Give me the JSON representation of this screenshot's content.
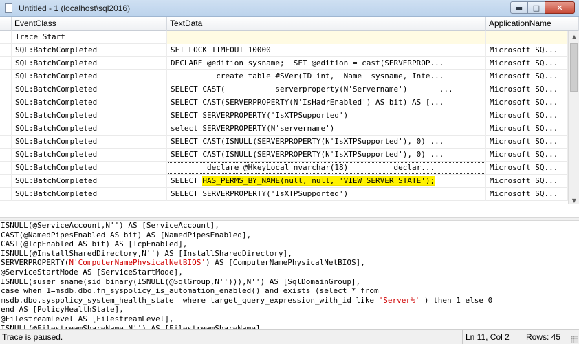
{
  "window": {
    "title": "Untitled - 1 (localhost\\sql2016)",
    "buttons": {
      "minimize": "▬",
      "maximize": "□",
      "close": "✕"
    }
  },
  "grid": {
    "columns": [
      "EventClass",
      "TextData",
      "ApplicationName"
    ],
    "rows": [
      {
        "event": "Trace Start",
        "text": "",
        "app": ""
      },
      {
        "event": "SQL:BatchCompleted",
        "text": "SET LOCK_TIMEOUT 10000",
        "app": "Microsoft SQ..."
      },
      {
        "event": "SQL:BatchCompleted",
        "text": "DECLARE @edition sysname;  SET @edition = cast(SERVERPROP...",
        "app": "Microsoft SQ..."
      },
      {
        "event": "SQL:BatchCompleted",
        "text": "          create table #SVer(ID int,  Name  sysname, Inte...",
        "app": "Microsoft SQ..."
      },
      {
        "event": "SQL:BatchCompleted",
        "text": "SELECT CAST(           serverproperty(N'Servername')       ...",
        "app": "Microsoft SQ..."
      },
      {
        "event": "SQL:BatchCompleted",
        "text": "SELECT CAST(SERVERPROPERTY(N'IsHadrEnabled') AS bit) AS [...",
        "app": "Microsoft SQ..."
      },
      {
        "event": "SQL:BatchCompleted",
        "text": "SELECT SERVERPROPERTY('IsXTPSupported')",
        "app": "Microsoft SQ..."
      },
      {
        "event": "SQL:BatchCompleted",
        "text": "select SERVERPROPERTY(N'servername')",
        "app": "Microsoft SQ..."
      },
      {
        "event": "SQL:BatchCompleted",
        "text": "SELECT CAST(ISNULL(SERVERPROPERTY(N'IsXTPSupported'), 0) ...",
        "app": "Microsoft SQ..."
      },
      {
        "event": "SQL:BatchCompleted",
        "text": "SELECT CAST(ISNULL(SERVERPROPERTY(N'IsXTPSupported'), 0) ...",
        "app": "Microsoft SQ..."
      },
      {
        "event": "SQL:BatchCompleted",
        "text": "        declare @HkeyLocal nvarchar(18)          declar...",
        "app": "Microsoft SQ..."
      },
      {
        "event": "SQL:BatchCompleted",
        "text_prefix": "SELECT ",
        "text_highlight": "HAS_PERMS_BY_NAME(null, null, 'VIEW SERVER STATE');",
        "app": "Microsoft SQ..."
      },
      {
        "event": "SQL:BatchCompleted",
        "text": "SELECT SERVERPROPERTY('IsXTPSupported')",
        "app": "Microsoft SQ..."
      }
    ]
  },
  "textpane": {
    "lines": [
      [
        {
          "t": "ISNULL(@ServiceAccount,N'') AS [ServiceAccount],"
        }
      ],
      [
        {
          "t": "CAST(@NamedPipesEnabled AS bit) AS [NamedPipesEnabled],"
        }
      ],
      [
        {
          "t": "CAST(@TcpEnabled AS bit) AS [TcpEnabled],"
        }
      ],
      [
        {
          "t": "ISNULL(@InstallSharedDirectory,N'') AS [InstallSharedDirectory],"
        }
      ],
      [
        {
          "t": "SERVERPROPERTY("
        },
        {
          "t": "N'ComputerNamePhysicalNetBIOS'",
          "red": true
        },
        {
          "t": ") AS [ComputerNamePhysicalNetBIOS],"
        }
      ],
      [
        {
          "t": "@ServiceStartMode AS [ServiceStartMode],"
        }
      ],
      [
        {
          "t": "ISNULL(suser_sname(sid_binary(ISNULL(@SqlGroup,N''))),N'') AS [SqlDomainGroup],"
        }
      ],
      [
        {
          "t": "case when 1=msdb.dbo.fn_syspolicy_is_automation_enabled() and exists (select * from"
        }
      ],
      [
        {
          "t": "msdb.dbo.syspolicy_system_health_state  where target_query_expression_with_id like "
        },
        {
          "t": "'Server%'",
          "red": true
        },
        {
          "t": " ) then 1 else 0"
        }
      ],
      [
        {
          "t": "end AS [PolicyHealthState],"
        }
      ],
      [
        {
          "t": "@FilestreamLevel AS [FilestreamLevel],"
        }
      ],
      [
        {
          "t": "ISNULL(@FilestreamShareName,N'') AS [FilestreamShareName],"
        }
      ]
    ]
  },
  "statusbar": {
    "message": "Trace is paused.",
    "position": "Ln 11, Col 2",
    "rows": "Rows: 45"
  }
}
